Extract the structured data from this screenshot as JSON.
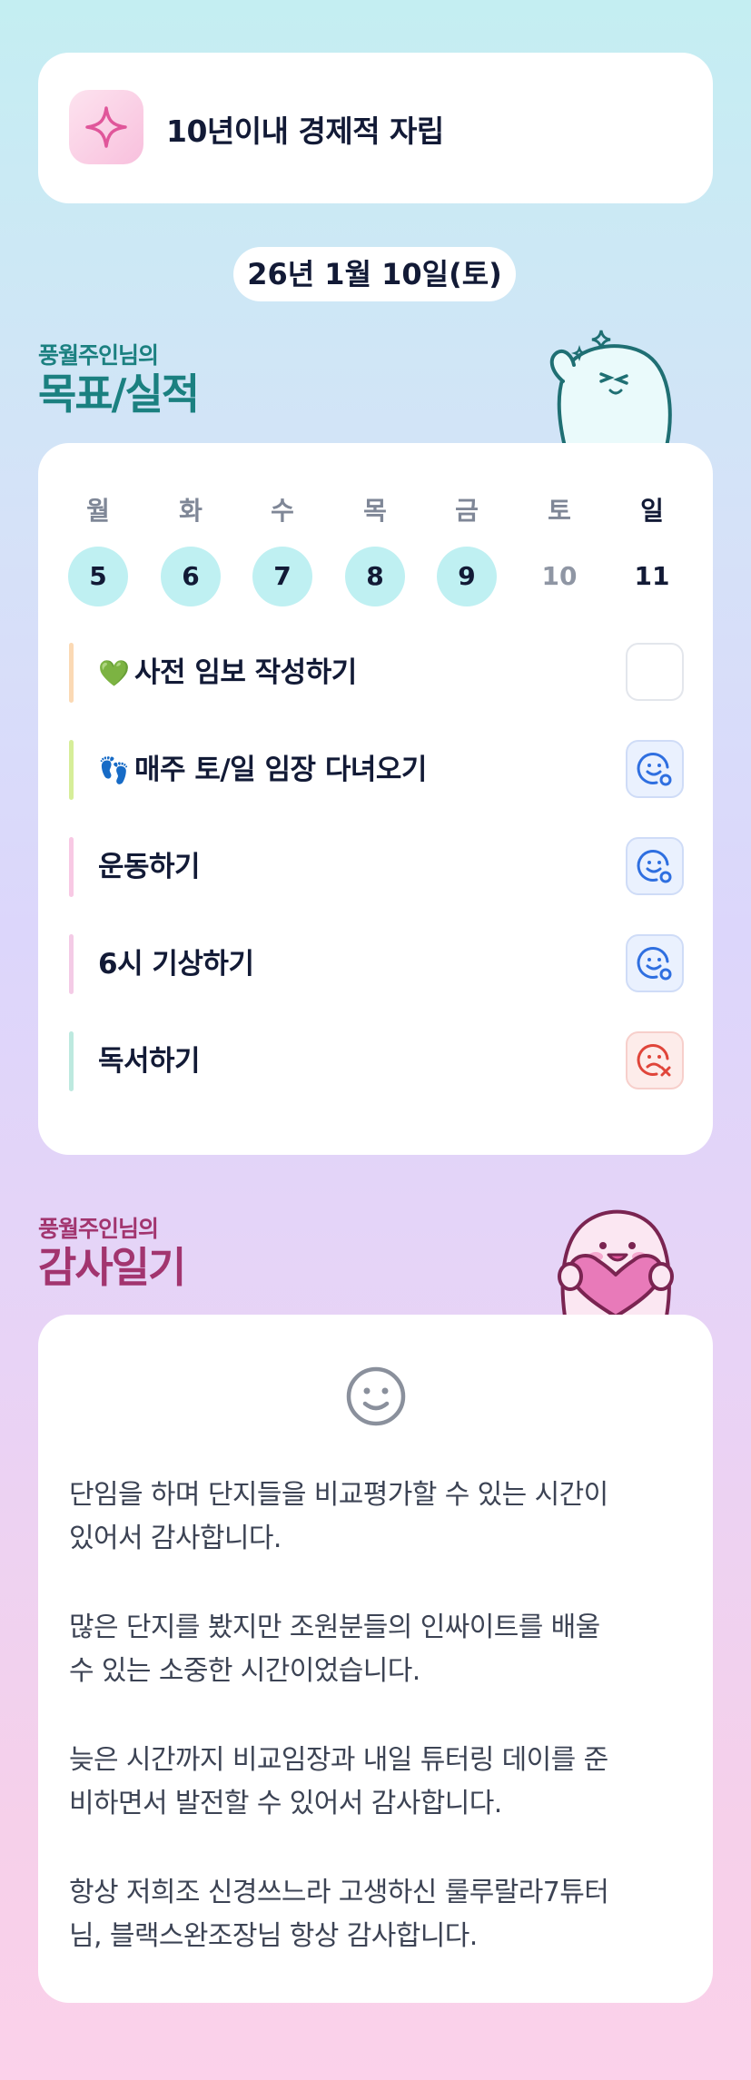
{
  "goal": {
    "title": "10년이내 경제적 자립",
    "icon": "sparkle-icon"
  },
  "date": "26년 1월 10일(토)",
  "goals_section": {
    "subtitle": "풍월주인님의",
    "title": "목표/실적"
  },
  "week": [
    {
      "label": "월",
      "num": "5",
      "state": "done"
    },
    {
      "label": "화",
      "num": "6",
      "state": "done"
    },
    {
      "label": "수",
      "num": "7",
      "state": "done"
    },
    {
      "label": "목",
      "num": "8",
      "state": "done"
    },
    {
      "label": "금",
      "num": "9",
      "state": "done"
    },
    {
      "label": "토",
      "num": "10",
      "state": "plain"
    },
    {
      "label": "일",
      "num": "11",
      "state": "today"
    }
  ],
  "tasks": [
    {
      "emoji": "💚",
      "label": "사전 임보 작성하기",
      "bar_color": "#fbd9b4",
      "status": "empty"
    },
    {
      "emoji": "👣",
      "label": "매주 토/일 임장 다녀오기",
      "bar_color": "#d6ee99",
      "status": "good"
    },
    {
      "emoji": "",
      "label": "운동하기",
      "bar_color": "#f8c9e4",
      "status": "good"
    },
    {
      "emoji": "",
      "label": "6시 기상하기",
      "bar_color": "#f4cbe6",
      "status": "good"
    },
    {
      "emoji": "",
      "label": "독서하기",
      "bar_color": "#bde9df",
      "status": "bad"
    }
  ],
  "gratitude_section": {
    "subtitle": "풍월주인님의",
    "title": "감사일기"
  },
  "diary": {
    "mood_icon": "smile-face-icon",
    "paragraphs": [
      "단임을 하며 단지들을 비교평가할 수 있는 시간이\n있어서 감사합니다.",
      "많은 단지를 봤지만 조원분들의 인싸이트를 배울\n수 있는 소중한 시간이었습니다.",
      "늦은 시간까지 비교임장과 내일 튜터링 데이를 준\n비하면서 발전할 수 있어서 감사합니다.",
      "항상 저희조 신경쓰느라 고생하신 룰루랄라7튜터\n님, 블랙스완조장님 항상 감사합니다."
    ]
  },
  "colors": {
    "teal": "#1b8080",
    "plum": "#a2356f",
    "done_day": "#bff0f2",
    "good_icon": "#2f6fe0",
    "bad_icon": "#e0453a"
  }
}
